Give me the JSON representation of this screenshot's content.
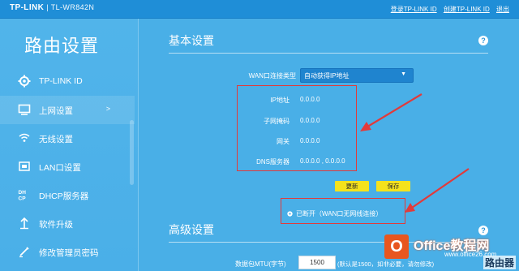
{
  "topbar": {
    "brand": "TP-LINK",
    "model": "| TL-WR842N",
    "link_login": "登录TP-LINK ID",
    "link_create": "创建TP-LINK ID",
    "link_exit": "退出"
  },
  "sidebar": {
    "title": "路由设置",
    "items": [
      {
        "label": "TP-LINK ID",
        "icon": "gear-icon"
      },
      {
        "label": "上网设置",
        "icon": "monitor-icon",
        "arrow": ">"
      },
      {
        "label": "无线设置",
        "icon": "wifi-icon"
      },
      {
        "label": "LAN口设置",
        "icon": "lan-icon"
      },
      {
        "label": "DHCP服务器",
        "icon": "dhcp-icon"
      },
      {
        "label": "软件升级",
        "icon": "upgrade-icon"
      },
      {
        "label": "修改管理员密码",
        "icon": "password-icon"
      }
    ]
  },
  "basic": {
    "title": "基本设置",
    "help": "?",
    "wan_label": "WAN口连接类型",
    "wan_value": "自动获得IP地址",
    "ip_label": "IP地址",
    "ip_value": "0.0.0.0",
    "mask_label": "子网掩码",
    "mask_value": "0.0.0.0",
    "gateway_label": "网关",
    "gateway_value": "0.0.0.0",
    "dns_label": "DNS服务器",
    "dns_value": "0.0.0.0 , 0.0.0.0",
    "refresh_btn": "更新",
    "save_btn": "保存",
    "status": "已断开（WAN口无网线连接）"
  },
  "advanced": {
    "title": "高级设置",
    "help": "?",
    "mtu_label": "数据包MTU(字节)",
    "mtu_value": "1500",
    "mtu_note": "(默认是1500，如非必要，请勿修改)"
  },
  "watermark": {
    "logo": "O",
    "text": "Office教程网",
    "site": "www.office26.com",
    "corner": "路由器"
  },
  "colors": {
    "background": "#49afe7",
    "topbar": "#1f8ed7",
    "button": "#f5e21c",
    "annotation": "#e23a3a"
  }
}
